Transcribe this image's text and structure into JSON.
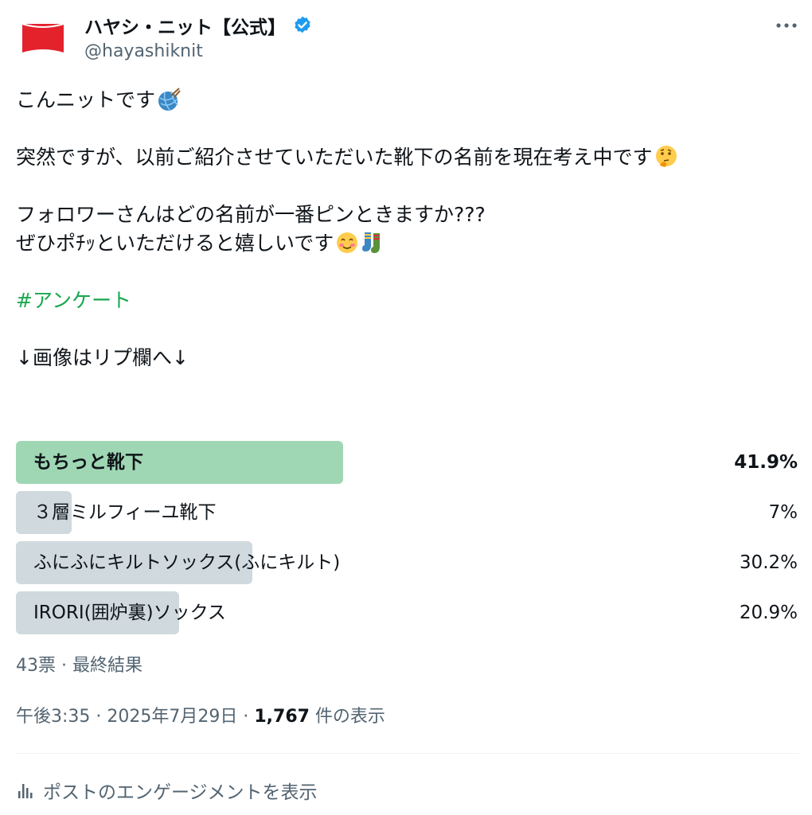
{
  "author": {
    "display_name": "ハヤシ・ニット【公式】",
    "handle": "@hayashiknit",
    "verified_icon": "verified-badge-icon",
    "more_icon": "more-options-icon"
  },
  "tweet": {
    "line1": "こんニットです",
    "line2": "突然ですが、以前ご紹介させていただいた靴下の名前を現在考え中です",
    "line3": "フォロワーさんはどの名前が一番ピンときますか???",
    "line4": "ぜひポﾁｯといただけると嬉しいです",
    "hashtag": "#アンケート",
    "line5": "↓画像はリプ欄へ↓",
    "emojis": [
      "yarn-ball-icon",
      "thinking-face-icon",
      "smiling-face-icon",
      "socks-icon"
    ]
  },
  "poll": {
    "options": [
      {
        "label": "もちっと靴下",
        "percent_text": "41.9%",
        "percent": 41.9,
        "winner": true
      },
      {
        "label": "３層ミルフィーユ靴下",
        "percent_text": "7%",
        "percent": 7,
        "winner": false
      },
      {
        "label": "ふにふにキルトソックス(ふにキルト)",
        "percent_text": "30.2%",
        "percent": 30.2,
        "winner": false
      },
      {
        "label": "IRORI(囲炉裏)ソックス",
        "percent_text": "20.9%",
        "percent": 20.9,
        "winner": false
      }
    ],
    "meta": "43票 · 最終結果"
  },
  "timestamp": {
    "prefix": "午後3:35 · 2025年7月29日 · ",
    "views": "1,767",
    "suffix": " 件の表示"
  },
  "engagement": {
    "label": "ポストのエンゲージメントを表示",
    "icon": "bar-chart-icon"
  },
  "colors": {
    "winner_bar": "#9fd7b4",
    "other_bar": "#cfd9de",
    "hashtag": "#1aa84f",
    "verified": "#1d9bf0",
    "brand_red": "#e3222c"
  }
}
